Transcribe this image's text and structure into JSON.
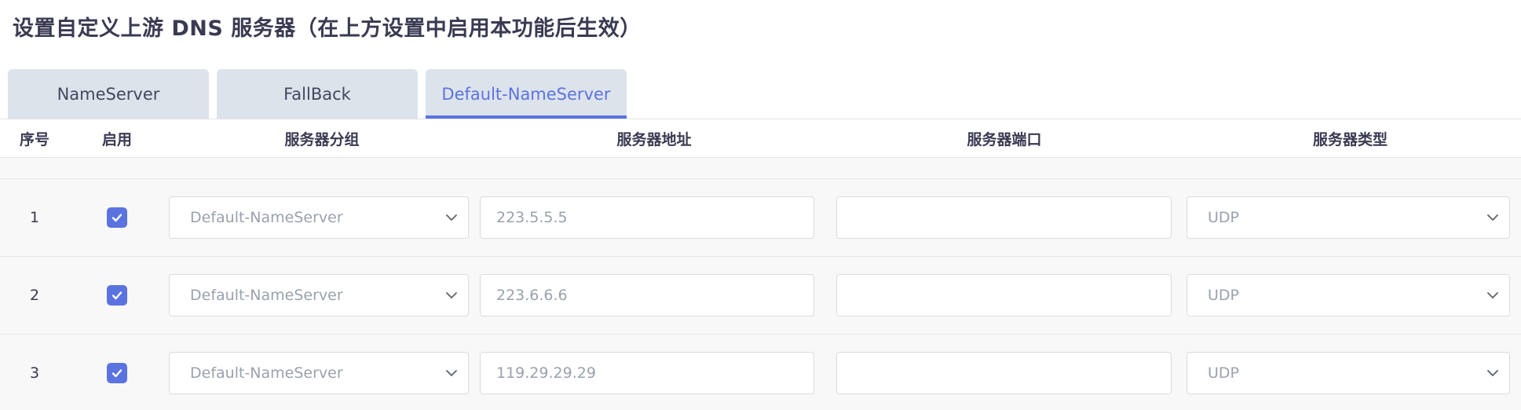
{
  "page": {
    "title": "设置自定义上游 DNS 服务器（在上方设置中启用本功能后生效）"
  },
  "tabs": [
    {
      "label": "NameServer",
      "active": false
    },
    {
      "label": "FallBack",
      "active": false
    },
    {
      "label": "Default-NameServer",
      "active": true
    }
  ],
  "table": {
    "headers": {
      "index": "序号",
      "enabled": "启用",
      "group": "服务器分组",
      "address": "服务器地址",
      "port": "服务器端口",
      "type": "服务器类型"
    },
    "rows": [
      {
        "index": "1",
        "enabled": true,
        "group": "Default-NameServer",
        "address": "223.5.5.5",
        "port": "",
        "type": "UDP"
      },
      {
        "index": "2",
        "enabled": true,
        "group": "Default-NameServer",
        "address": "223.6.6.6",
        "port": "",
        "type": "UDP"
      },
      {
        "index": "3",
        "enabled": true,
        "group": "Default-NameServer",
        "address": "119.29.29.29",
        "port": "",
        "type": "UDP"
      }
    ]
  },
  "icons": {
    "checkbox": "check-icon",
    "dropdown": "chevron-down-icon"
  },
  "colors": {
    "accent": "#5b73e0",
    "tab_bg": "#dde3eb",
    "row_bg": "#f8f8f9"
  }
}
